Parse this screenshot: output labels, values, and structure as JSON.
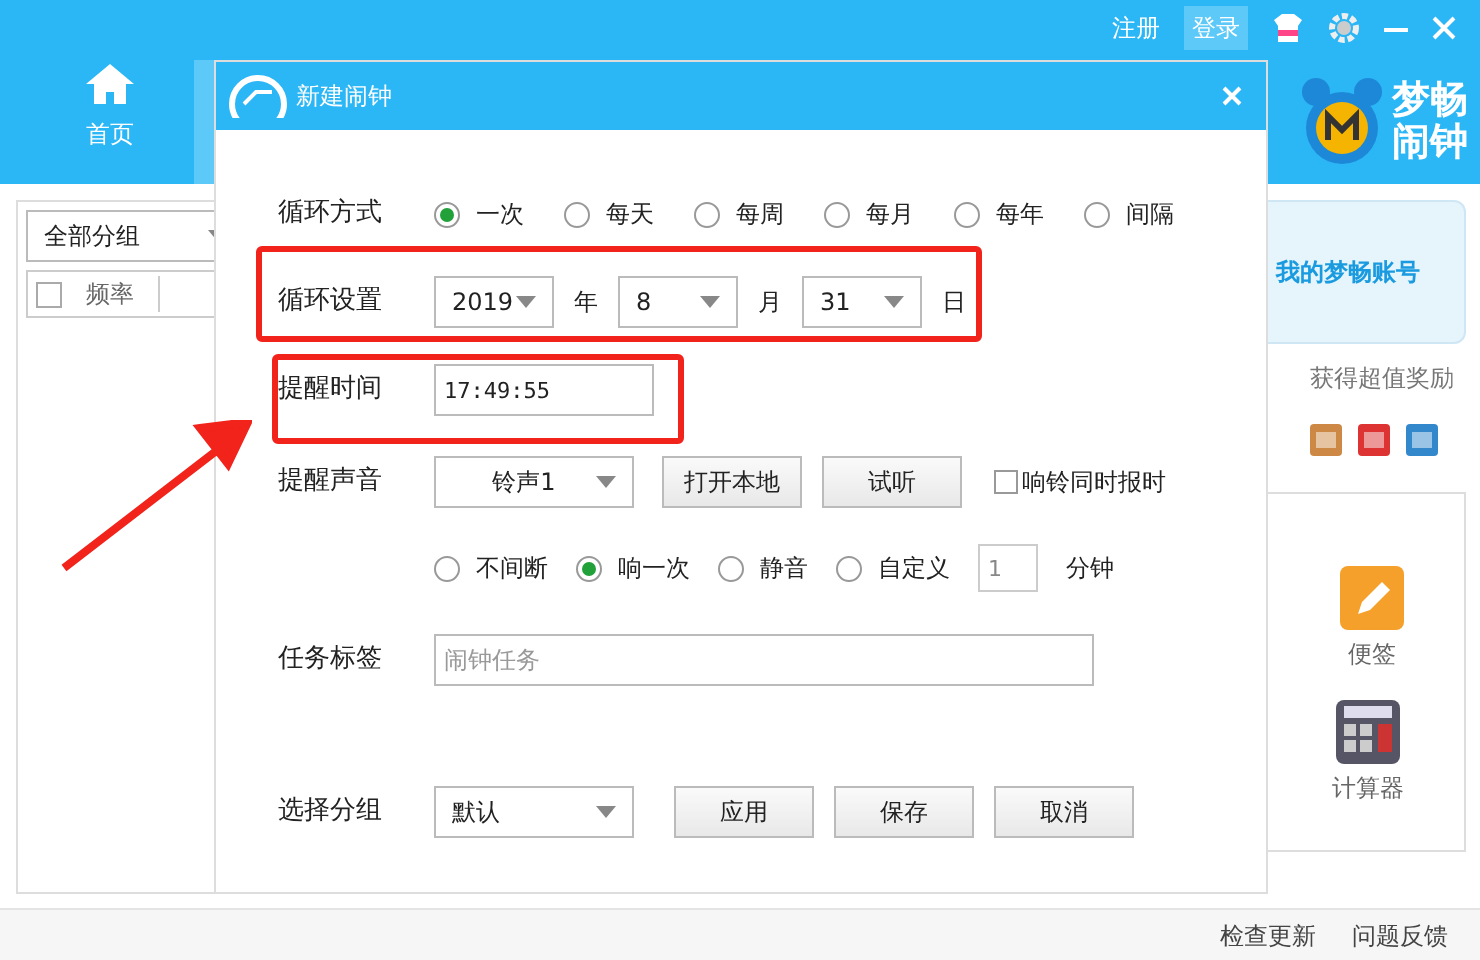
{
  "header": {
    "nav": [
      {
        "label": "首页",
        "selected": false
      },
      {
        "selected": true
      }
    ],
    "top_links": [
      "注册",
      "登录"
    ],
    "logo": [
      "梦畅",
      "闹钟"
    ]
  },
  "left_panel": {
    "group_select": "全部分组",
    "columns": [
      {
        "kind": "checkbox",
        "checked": false
      },
      {
        "kind": "text",
        "label": "频率"
      }
    ]
  },
  "right_panel": {
    "account_button": "我的梦畅账号",
    "reward_text": "获得超值奖励",
    "tools": [
      {
        "kind": "note",
        "label": "便签"
      },
      {
        "kind": "calculator",
        "label": "计算器"
      }
    ]
  },
  "dialog": {
    "title": "新建闹钟",
    "repeat_label": "循环方式",
    "repeat_options": [
      {
        "label": "一次",
        "selected": true
      },
      {
        "label": "每天",
        "selected": false
      },
      {
        "label": "每周",
        "selected": false
      },
      {
        "label": "每月",
        "selected": false
      },
      {
        "label": "每年",
        "selected": false
      },
      {
        "label": "间隔",
        "selected": false
      }
    ],
    "date_label": "循环设置",
    "date": [
      {
        "value": "2019",
        "unit": "年"
      },
      {
        "value": "8",
        "unit": "月"
      },
      {
        "value": "31",
        "unit": "日"
      }
    ],
    "time_label": "提醒时间",
    "time": "17:49:55",
    "sound_label": "提醒声音",
    "sound": "铃声1",
    "sound_buttons": [
      "打开本地",
      "试听"
    ],
    "announce": {
      "label": "响铃同时报时",
      "checked": false
    },
    "ring_modes": [
      {
        "label": "不间断",
        "selected": false
      },
      {
        "label": "响一次",
        "selected": true
      },
      {
        "label": "静音",
        "selected": false
      },
      {
        "label": "自定义",
        "selected": false
      }
    ],
    "custom_minutes": "1",
    "minutes_unit": "分钟",
    "tag_label": "任务标签",
    "tag_placeholder": "闹钟任务",
    "group_label": "选择分组",
    "group": "默认",
    "buttons": [
      "应用",
      "保存",
      "取消"
    ]
  },
  "status_bar": [
    "检查更新",
    "问题反馈"
  ]
}
